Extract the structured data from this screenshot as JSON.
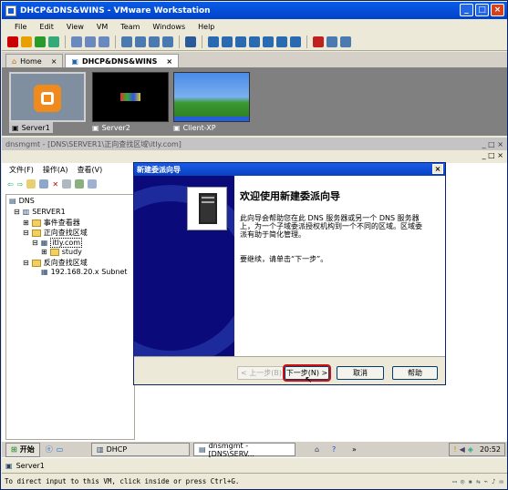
{
  "window": {
    "title": "DHCP&DNS&WINS - VMware Workstation"
  },
  "menu": [
    "File",
    "Edit",
    "View",
    "VM",
    "Team",
    "Windows",
    "Help"
  ],
  "tabs": [
    {
      "label": "Home"
    },
    {
      "label": "DHCP&DNS&WINS"
    }
  ],
  "thumbnails": [
    {
      "label": "Server1"
    },
    {
      "label": "Server2"
    },
    {
      "label": "Client-XP"
    }
  ],
  "guest": {
    "title": "dnsmgmt - [DNS\\SERVER1\\正向查找区域\\itly.com]",
    "mmc_menu": [
      "文件(F)",
      "操作(A)",
      "查看(V)"
    ],
    "tree": {
      "root": "DNS",
      "server": "SERVER1",
      "event_viewer": "事件查看器",
      "forward_zone": "正向查找区域",
      "zone": "itly.com",
      "subzone": "study",
      "reverse_zone": "反向查找区域",
      "reverse_subnet": "192.168.20.x Subnet"
    }
  },
  "wizard": {
    "title": "新建委派向导",
    "heading": "欢迎使用新建委派向导",
    "body1": "此向导会帮助您在此 DNS 服务器或另一个 DNS 服务器上，为一个子域委派授权机构到一个不同的区域。区域委派有助于简化管理。",
    "body2": "要继续，请单击“下一步”。",
    "back": "< 上一步(B)",
    "next": "下一步(N) >",
    "cancel": "取消",
    "help": "帮助"
  },
  "taskbar": {
    "start": "开始",
    "tasks": [
      "DHCP",
      "dnsmgmt - [DNS\\SERV..."
    ],
    "clock": "20:52"
  },
  "status_tab": "Server1",
  "status": "To direct input to this VM, click inside or press Ctrl+G.",
  "colors": {
    "title_bar": "#0a5de8",
    "wizard_band": "#0a0a7a",
    "focus_ring": "#d01010"
  }
}
